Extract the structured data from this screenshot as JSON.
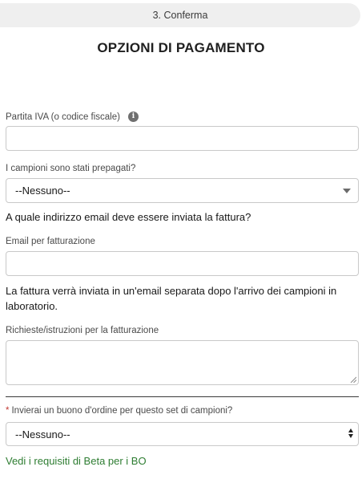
{
  "stepper": {
    "current_step": "3. Conferma"
  },
  "page": {
    "title": "OPZIONI DI PAGAMENTO"
  },
  "form": {
    "vat": {
      "label": "Partita IVA (o codice fiscale)",
      "info_icon": "info-icon",
      "value": ""
    },
    "prepaid": {
      "label": "I campioni sono stati prepagati?",
      "value": "--Nessuno--"
    },
    "email_question": "A quale indirizzo email deve essere inviata la fattura?",
    "billing_email": {
      "label": "Email per fatturazione",
      "value": ""
    },
    "invoice_note": "La fattura verrà inviata in un'email separata dopo l'arrivo dei campioni in laboratorio.",
    "billing_instructions": {
      "label": "Richieste/istruzioni per la fatturazione",
      "value": ""
    },
    "purchase_order": {
      "required_mark": "*",
      "label": "Invierai un buono d'ordine per questo set di campioni?",
      "value": "--Nessuno--"
    },
    "requirements_link": "Vedi i requisiti di Beta per i BO"
  },
  "colors": {
    "link": "#2e7d32",
    "required": "#c23934",
    "step_bg": "#efefef"
  }
}
